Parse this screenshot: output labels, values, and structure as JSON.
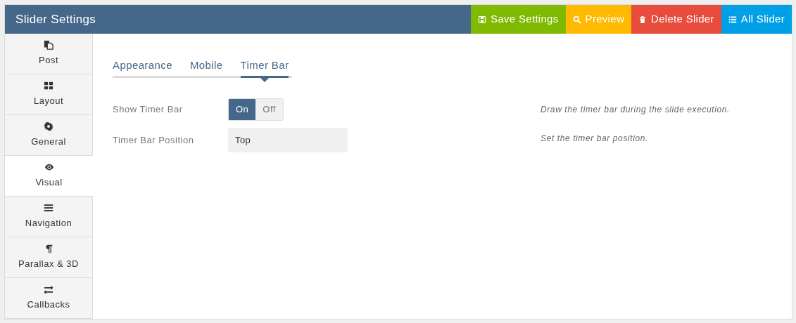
{
  "header": {
    "title": "Slider Settings"
  },
  "actions": [
    {
      "label": "Save Settings",
      "kind": "save",
      "color": "#7fba00"
    },
    {
      "label": "Preview",
      "kind": "preview",
      "color": "#ffb900"
    },
    {
      "label": "Delete Slider",
      "kind": "delete",
      "color": "#e74c3c"
    },
    {
      "label": "All Slider",
      "kind": "list",
      "color": "#00a0e6"
    }
  ],
  "sidebar": {
    "items": [
      {
        "label": "Post",
        "kind": "copy",
        "selected": false
      },
      {
        "label": "Layout",
        "kind": "grid",
        "selected": false
      },
      {
        "label": "General",
        "kind": "gear",
        "selected": false
      },
      {
        "label": "Visual",
        "kind": "eye",
        "selected": true
      },
      {
        "label": "Navigation",
        "kind": "bars",
        "selected": false
      },
      {
        "label": "Parallax & 3D",
        "kind": "pilcrow",
        "selected": false
      },
      {
        "label": "Callbacks",
        "kind": "exchange",
        "selected": false
      }
    ]
  },
  "tabs": [
    {
      "label": "Appearance",
      "selected": false
    },
    {
      "label": "Mobile",
      "selected": false
    },
    {
      "label": "Timer Bar",
      "selected": true
    }
  ],
  "settings": [
    {
      "kind": "toggle",
      "label": "Show Timer Bar",
      "options": [
        {
          "label": "On",
          "selected": true
        },
        {
          "label": "Off",
          "selected": false
        }
      ],
      "help": "Draw the timer bar during the slide execution."
    },
    {
      "kind": "select",
      "label": "Timer Bar Position",
      "value": "Top",
      "help": "Set the timer bar position."
    }
  ]
}
